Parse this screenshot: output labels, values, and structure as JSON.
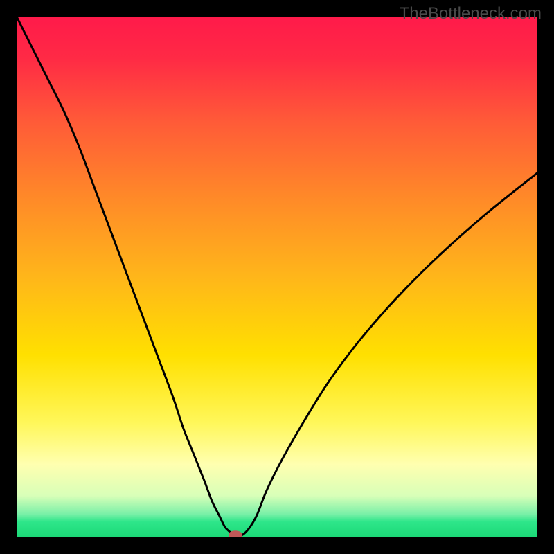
{
  "watermark": "TheBottleneck.com",
  "chart_data": {
    "type": "line",
    "title": "",
    "xlabel": "",
    "ylabel": "",
    "xlim": [
      0,
      100
    ],
    "ylim": [
      0,
      100
    ],
    "background_gradient": {
      "stops": [
        {
          "offset": 0.0,
          "color": "#ff1a4a"
        },
        {
          "offset": 0.08,
          "color": "#ff2a45"
        },
        {
          "offset": 0.2,
          "color": "#ff5a38"
        },
        {
          "offset": 0.35,
          "color": "#ff8a28"
        },
        {
          "offset": 0.5,
          "color": "#ffb61a"
        },
        {
          "offset": 0.65,
          "color": "#ffe000"
        },
        {
          "offset": 0.78,
          "color": "#fff75a"
        },
        {
          "offset": 0.86,
          "color": "#ffffb0"
        },
        {
          "offset": 0.92,
          "color": "#d8ffb8"
        },
        {
          "offset": 0.955,
          "color": "#7af0a8"
        },
        {
          "offset": 0.97,
          "color": "#2ee68a"
        },
        {
          "offset": 1.0,
          "color": "#1bd876"
        }
      ]
    },
    "series": [
      {
        "name": "bottleneck-curve",
        "x": [
          0,
          1,
          3,
          6,
          9,
          12,
          15,
          18,
          21,
          24,
          27,
          30,
          32,
          34,
          36,
          37.5,
          39,
          40,
          41,
          42,
          44,
          46,
          48,
          51,
          55,
          60,
          66,
          73,
          81,
          90,
          100
        ],
        "values": [
          100,
          98,
          94,
          88,
          82,
          75,
          67,
          59,
          51,
          43,
          35,
          27,
          21,
          16,
          11,
          7,
          4,
          2,
          1,
          0,
          1,
          4,
          9,
          15,
          22,
          30,
          38,
          46,
          54,
          62,
          70
        ]
      }
    ],
    "marker": {
      "name": "optimal-point",
      "x": 42,
      "y": 0.5,
      "color": "#c15858",
      "rx": 10,
      "ry": 6
    }
  }
}
